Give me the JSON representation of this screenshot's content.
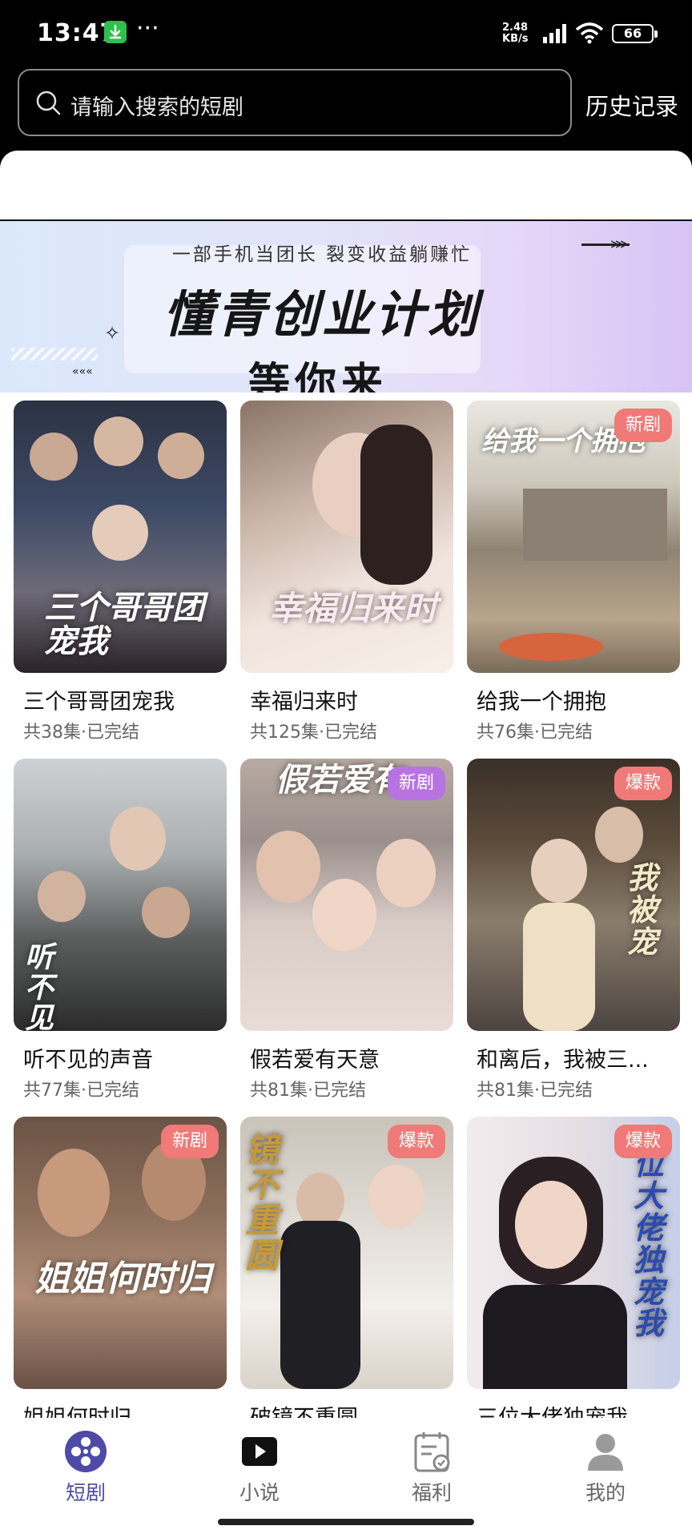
{
  "status_bar": {
    "time": "13:47",
    "more": "···",
    "net_speed_value": "2.48",
    "net_speed_unit": "KB/s",
    "battery": "66"
  },
  "header": {
    "search_placeholder": "请输入搜索的短剧",
    "history_label": "历史记录"
  },
  "banner": {
    "tagline": "一部手机当团长 裂变收益躺赚忙",
    "title": "懂青创业计划",
    "subtitle": "等你来"
  },
  "dramas": [
    {
      "title": "三个哥哥团宠我",
      "meta": "共38集·已完结",
      "badge": "",
      "poster_text": "三个哥哥团宠我"
    },
    {
      "title": "幸福归来时",
      "meta": "共125集·已完结",
      "badge": "",
      "poster_text": "幸福归来时"
    },
    {
      "title": "给我一个拥抱",
      "meta": "共76集·已完结",
      "badge": "新剧",
      "poster_text": "给我一个拥抱"
    },
    {
      "title": "听不见的声音",
      "meta": "共77集·已完结",
      "badge": "",
      "poster_text": "听不见的声"
    },
    {
      "title": "假若爱有天意",
      "meta": "共81集·已完结",
      "badge": "新剧",
      "poster_text": "假若爱有"
    },
    {
      "title": "和离后，我被三...",
      "meta": "共81集·已完结",
      "badge": "爆款",
      "poster_text": "我被宠"
    },
    {
      "title": "姐姐何时归",
      "meta": "",
      "badge": "新剧",
      "poster_text": "姐姐何时归"
    },
    {
      "title": "破镜不重圆",
      "meta": "",
      "badge": "爆款",
      "poster_text": "镜不重圆"
    },
    {
      "title": "三位大佬独宠我",
      "meta": "",
      "badge": "爆款",
      "poster_text": "位大佬独宠我"
    }
  ],
  "bottom_nav": [
    {
      "label": "短剧",
      "icon": "film-reel-icon",
      "active": true
    },
    {
      "label": "小说",
      "icon": "play-icon",
      "active": false
    },
    {
      "label": "福利",
      "icon": "checklist-icon",
      "active": false
    },
    {
      "label": "我的",
      "icon": "user-icon",
      "active": false
    }
  ],
  "colors": {
    "accent": "#4e4aa6",
    "badge_red": "#f07a78",
    "badge_purple": "#b774e0"
  }
}
